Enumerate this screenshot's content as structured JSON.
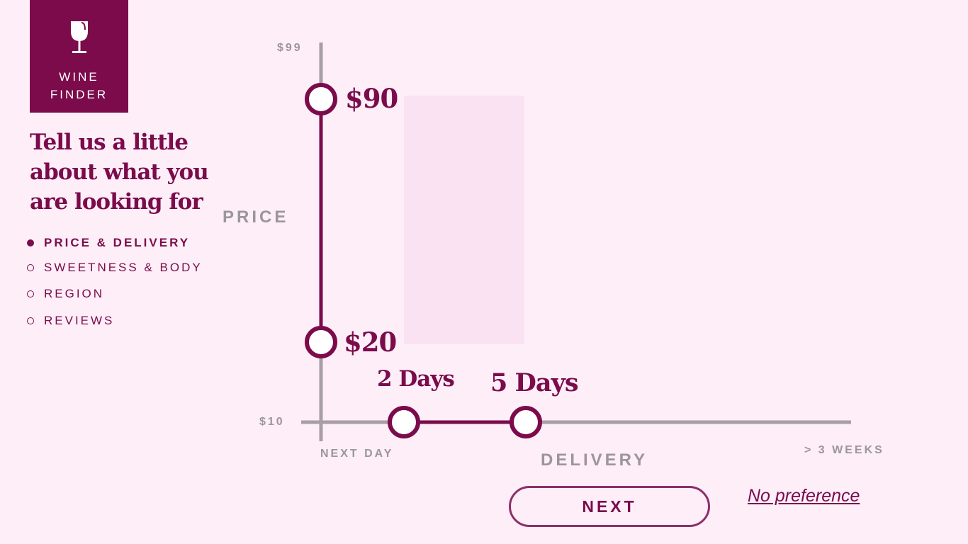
{
  "brand": {
    "line1": "WINE",
    "line2": "FINDER",
    "icon": "wine-glass-icon",
    "color": "#7b0b4b"
  },
  "headline": "Tell us a little about what you are looking for",
  "steps": [
    {
      "label": "PRICE & DELIVERY",
      "active": true
    },
    {
      "label": "SWEETNESS & BODY",
      "active": false
    },
    {
      "label": "REGION",
      "active": false
    },
    {
      "label": "REVIEWS",
      "active": false
    }
  ],
  "price": {
    "axis_label": "PRICE",
    "min_label": "$10",
    "max_label": "$99",
    "low_value": "$20",
    "high_value": "$90"
  },
  "delivery": {
    "axis_label": "DELIVERY",
    "min_label": "NEXT DAY",
    "max_label": "> 3 WEEKS",
    "low_value": "2 Days",
    "high_value": "5 Days"
  },
  "actions": {
    "next_label": "NEXT",
    "no_preference_label": "No preference"
  },
  "colors": {
    "accent": "#7b0b4b",
    "axis": "#a79fa4",
    "background": "#fdeef8",
    "range_fill": "#fbe2f2"
  }
}
